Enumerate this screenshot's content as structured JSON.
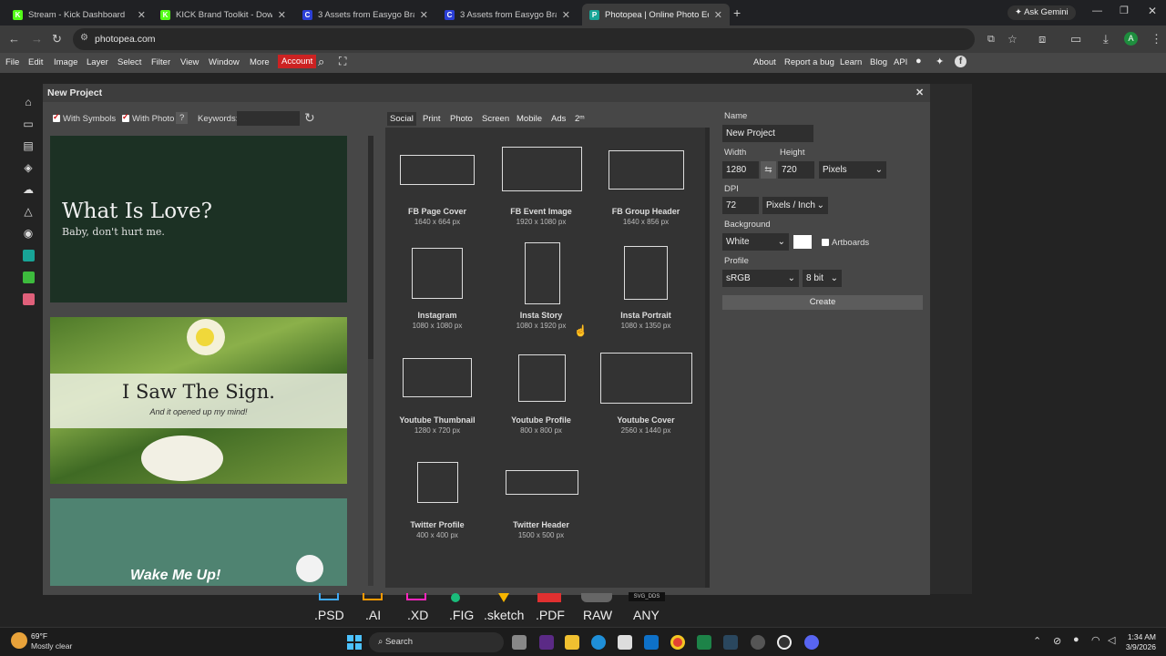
{
  "browser": {
    "tabs": [
      {
        "title": "Stream - Kick Dashboard",
        "fav": "K",
        "fav_color": "#53fc18"
      },
      {
        "title": "KICK Brand Toolkit - Download",
        "fav": "K",
        "fav_color": "#53fc18"
      },
      {
        "title": "3 Assets from Easygo Brandfolder",
        "fav": "C",
        "fav_color": "#2b3fd6"
      },
      {
        "title": "3 Assets from Easygo Brandfolder",
        "fav": "C",
        "fav_color": "#2b3fd6"
      },
      {
        "title": "Photopea | Online Photo Editor",
        "fav": "P",
        "fav_color": "#18a497"
      }
    ],
    "ask_gemini": "Ask Gemini",
    "url": "photopea.com",
    "profile_initial": "A"
  },
  "menu": {
    "items": [
      "File",
      "Edit",
      "Image",
      "Layer",
      "Select",
      "Filter",
      "View",
      "Window",
      "More"
    ],
    "account": "Account",
    "right_items": [
      "About",
      "Report a bug",
      "Learn",
      "Blog",
      "API"
    ]
  },
  "dialog": {
    "title": "New Project",
    "with_symbols": "With Symbols",
    "with_photo": "With Photo",
    "help": "?",
    "keywords_label": "Keywords:",
    "templates": [
      {
        "title": "What Is Love?",
        "subtitle": "Baby, don't hurt me."
      },
      {
        "title": "I Saw The Sign.",
        "subtitle": "And it opened up my mind!"
      },
      {
        "title": "Wake Me Up!",
        "subtitle": ""
      }
    ],
    "tabs": [
      "Social",
      "Print",
      "Photo",
      "Screen",
      "Mobile",
      "Ads",
      "2ᵐ"
    ],
    "active_tab": "Social",
    "presets": [
      {
        "name": "FB Page Cover",
        "size": "1640 x 664 px"
      },
      {
        "name": "FB Event Image",
        "size": "1920 x 1080 px"
      },
      {
        "name": "FB Group Header",
        "size": "1640 x 856 px"
      },
      {
        "name": "Instagram",
        "size": "1080 x 1080 px"
      },
      {
        "name": "Insta Story",
        "size": "1080 x 1920 px"
      },
      {
        "name": "Insta Portrait",
        "size": "1080 x 1350 px"
      },
      {
        "name": "Youtube Thumbnail",
        "size": "1280 x 720 px"
      },
      {
        "name": "Youtube Profile",
        "size": "800 x 800 px"
      },
      {
        "name": "Youtube Cover",
        "size": "2560 x 1440 px"
      },
      {
        "name": "Twitter Profile",
        "size": "400 x 400 px"
      },
      {
        "name": "Twitter Header",
        "size": "1500 x 500 px"
      }
    ],
    "form": {
      "name_label": "Name",
      "name_value": "New Project",
      "width_label": "Width",
      "width_value": "1280",
      "height_label": "Height",
      "height_value": "720",
      "unit": "Pixels",
      "dpi_label": "DPI",
      "dpi_value": "72",
      "dpi_unit": "Pixels / Inch",
      "background_label": "Background",
      "background_value": "White",
      "artboards": "Artboards",
      "profile_label": "Profile",
      "profile_value": "sRGB",
      "bit_value": "8 bit",
      "create": "Create"
    }
  },
  "formats": [
    ".PSD",
    ".AI",
    ".XD",
    ".FIG",
    ".sketch",
    ".PDF",
    "RAW",
    "ANY"
  ],
  "format_icon_caption": "SVG_DDS",
  "taskbar": {
    "weather_temp": "69°F",
    "weather_desc": "Mostly clear",
    "search": "Search",
    "time": "1:34 AM",
    "date": "3/9/2026"
  }
}
